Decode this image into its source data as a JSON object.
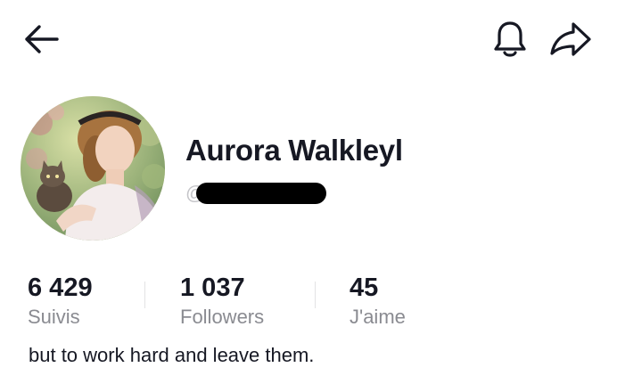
{
  "header": {
    "back_icon": "arrow-left-icon",
    "notify_icon": "bell-icon",
    "share_icon": "share-arrow-icon"
  },
  "profile": {
    "display_name": "Aurora Walkleyl",
    "username": "@i",
    "username_redacted": true,
    "avatar": "portrait-painting-woman-with-kitten"
  },
  "stats": [
    {
      "value": "6 429",
      "label": "Suivis"
    },
    {
      "value": "1 037",
      "label": "Followers"
    },
    {
      "value": "45",
      "label": "J'aime"
    }
  ],
  "bio": "but to work hard and leave them.",
  "colors": {
    "text_primary": "#161823",
    "text_secondary": "#8a8b91",
    "background": "#ffffff",
    "divider": "#e3e3e4"
  }
}
